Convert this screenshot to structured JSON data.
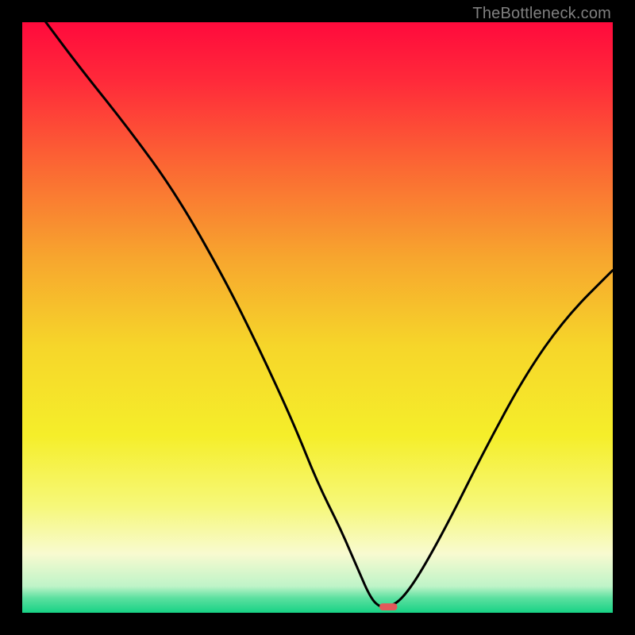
{
  "watermark": "TheBottleneck.com",
  "chart_data": {
    "type": "line",
    "title": "",
    "xlabel": "",
    "ylabel": "",
    "xlim": [
      0,
      100
    ],
    "ylim": [
      0,
      100
    ],
    "background": {
      "style": "vertical-gradient",
      "stops": [
        {
          "pos": 0.0,
          "color": "#FF0A3C"
        },
        {
          "pos": 0.1,
          "color": "#FF2A3A"
        },
        {
          "pos": 0.25,
          "color": "#FB6A33"
        },
        {
          "pos": 0.4,
          "color": "#F7A62E"
        },
        {
          "pos": 0.55,
          "color": "#F6D62A"
        },
        {
          "pos": 0.7,
          "color": "#F5EE2A"
        },
        {
          "pos": 0.82,
          "color": "#F6F87A"
        },
        {
          "pos": 0.9,
          "color": "#F8FAD0"
        },
        {
          "pos": 0.955,
          "color": "#BFF4C8"
        },
        {
          "pos": 0.975,
          "color": "#5CE0A0"
        },
        {
          "pos": 1.0,
          "color": "#17D285"
        }
      ]
    },
    "series": [
      {
        "name": "bottleneck-curve",
        "color": "#000000",
        "x": [
          4,
          10,
          18,
          26,
          34,
          40,
          46,
          50,
          54,
          57,
          59,
          60.5,
          62,
          64,
          67,
          72,
          78,
          85,
          92,
          100
        ],
        "y": [
          100,
          92,
          82,
          71,
          57,
          45,
          32,
          22,
          14,
          7,
          2.5,
          1,
          1,
          2,
          6,
          15,
          27,
          40,
          50,
          58
        ]
      }
    ],
    "markers": [
      {
        "name": "optimal-point",
        "shape": "pill",
        "x": 62,
        "y": 1,
        "width_pct": 3.0,
        "height_pct": 1.2,
        "color": "#E25A5A"
      }
    ]
  }
}
